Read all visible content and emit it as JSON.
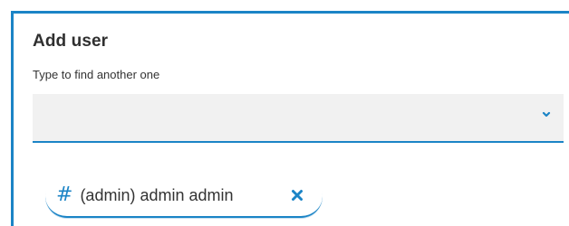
{
  "section": {
    "title": "Add user",
    "hint": "Type to find another one"
  },
  "select": {
    "value": "",
    "icon": "chevron-down-icon"
  },
  "tags": [
    {
      "icon": "#",
      "label": "(admin) admin admin",
      "remove_icon": "close-icon"
    }
  ],
  "colors": {
    "accent": "#1b84c6",
    "field_bg": "#f1f1f1",
    "text": "#333333",
    "title": "#2f2f2f"
  }
}
